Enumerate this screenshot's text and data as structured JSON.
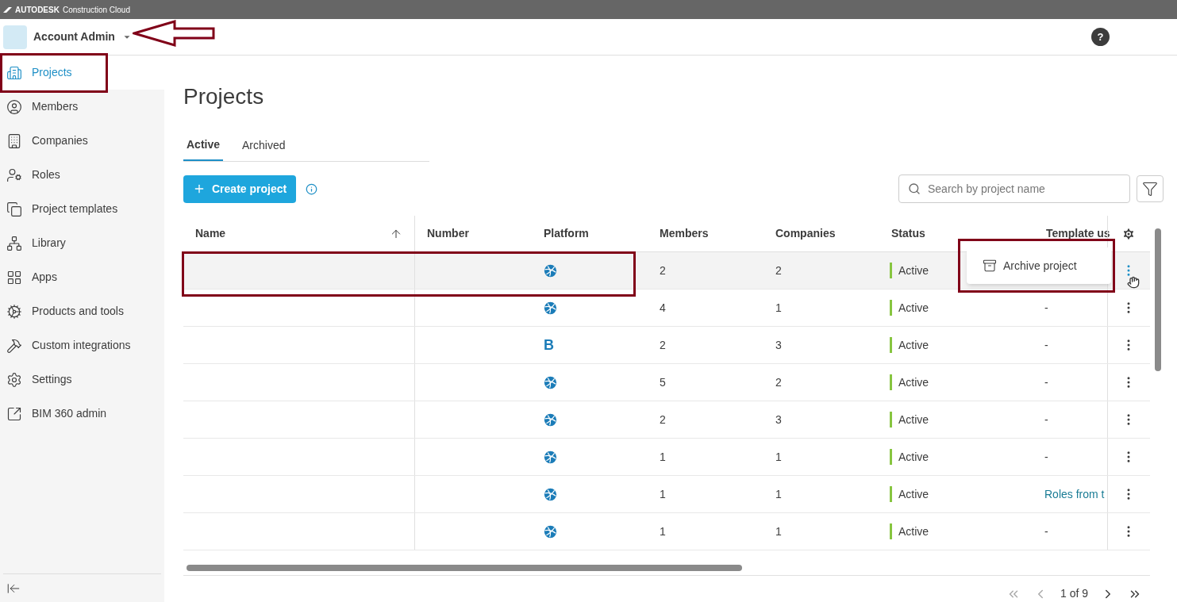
{
  "brand": {
    "logo": "AUTODESK",
    "product": "Construction Cloud"
  },
  "header": {
    "account": "Account Admin",
    "help": "?"
  },
  "sidebar": {
    "items": [
      {
        "label": "Projects",
        "selected": true
      },
      {
        "label": "Members",
        "selected": false
      },
      {
        "label": "Companies",
        "selected": false
      },
      {
        "label": "Roles",
        "selected": false
      },
      {
        "label": "Project templates",
        "selected": false
      },
      {
        "label": "Library",
        "selected": false
      },
      {
        "label": "Apps",
        "selected": false
      },
      {
        "label": "Products and tools",
        "selected": false
      },
      {
        "label": "Custom integrations",
        "selected": false
      },
      {
        "label": "Settings",
        "selected": false
      },
      {
        "label": "BIM 360 admin",
        "selected": false
      }
    ]
  },
  "page": {
    "title": "Projects",
    "tabs": [
      {
        "label": "Active",
        "selected": true
      },
      {
        "label": "Archived",
        "selected": false
      }
    ],
    "create_button": "Create project",
    "search": {
      "placeholder": "Search by project name"
    }
  },
  "table": {
    "columns": [
      {
        "label": "Name",
        "sorted": true
      },
      {
        "label": "Number",
        "sorted": false
      },
      {
        "label": "Platform",
        "sorted": false
      },
      {
        "label": "Members",
        "sorted": false
      },
      {
        "label": "Companies",
        "sorted": false
      },
      {
        "label": "Status",
        "sorted": false
      },
      {
        "label": "Template us",
        "sorted": false
      }
    ],
    "rows": [
      {
        "platform": {
          "kind": "globe"
        },
        "members": "2",
        "companies": "2",
        "status": "Active",
        "selected": true
      },
      {
        "platform": {
          "kind": "globe"
        },
        "members": "4",
        "companies": "1",
        "status": "Active",
        "template": "-",
        "selected": false
      },
      {
        "platform": {
          "kind": "bim",
          "glyph": "B"
        },
        "members": "2",
        "companies": "3",
        "status": "Active",
        "template": "-",
        "selected": false
      },
      {
        "platform": {
          "kind": "globe"
        },
        "members": "5",
        "companies": "2",
        "status": "Active",
        "template": "-",
        "selected": false
      },
      {
        "platform": {
          "kind": "globe"
        },
        "members": "2",
        "companies": "3",
        "status": "Active",
        "template": "-",
        "selected": false
      },
      {
        "platform": {
          "kind": "globe"
        },
        "members": "1",
        "companies": "1",
        "status": "Active",
        "template": "-",
        "selected": false
      },
      {
        "platform": {
          "kind": "globe"
        },
        "members": "1",
        "companies": "1",
        "status": "Active",
        "template": "Roles from t",
        "template_link": true,
        "selected": false
      },
      {
        "platform": {
          "kind": "globe"
        },
        "members": "1",
        "companies": "1",
        "status": "Active",
        "template": "-",
        "selected": false
      }
    ]
  },
  "menu": {
    "items": [
      {
        "label": "Archive project"
      }
    ]
  },
  "pagination": {
    "label": "1 of 9"
  }
}
